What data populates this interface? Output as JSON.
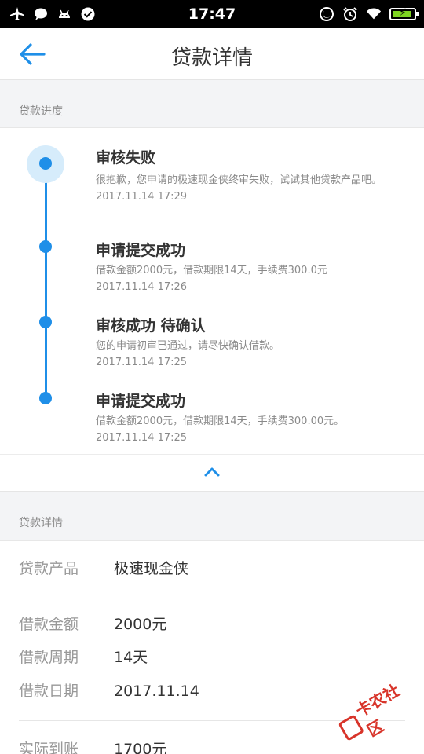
{
  "status_bar": {
    "time": "17:47"
  },
  "header": {
    "title": "贷款详情"
  },
  "progress": {
    "label": "贷款进度",
    "steps": [
      {
        "title": "审核失败",
        "desc": "很抱歉，您申请的极速现金侠终审失败，试试其他贷款产品吧。",
        "time": "2017.11.14 17:29"
      },
      {
        "title": "申请提交成功",
        "desc": "借款金额2000元，借款期限14天，手续费300.0元",
        "time": "2017.11.14 17:26"
      },
      {
        "title": "审核成功 待确认",
        "desc": "您的申请初审已通过，请尽快确认借款。",
        "time": "2017.11.14 17:25"
      },
      {
        "title": "申请提交成功",
        "desc": "借款金额2000元，借款期限14天，手续费300.00元。",
        "time": "2017.11.14 17:25"
      }
    ]
  },
  "details": {
    "label": "贷款详情",
    "rows": [
      {
        "label": "贷款产品",
        "value": "极速现金侠"
      },
      {
        "label": "借款金额",
        "value": "2000元"
      },
      {
        "label": "借款周期",
        "value": "14天"
      },
      {
        "label": "借款日期",
        "value": "2017.11.14"
      },
      {
        "label": "实际到账",
        "value": "1700元"
      }
    ]
  },
  "watermark": {
    "text": "卡农社区"
  },
  "colors": {
    "accent": "#1f8fe8",
    "background": "#f3f4f6"
  }
}
